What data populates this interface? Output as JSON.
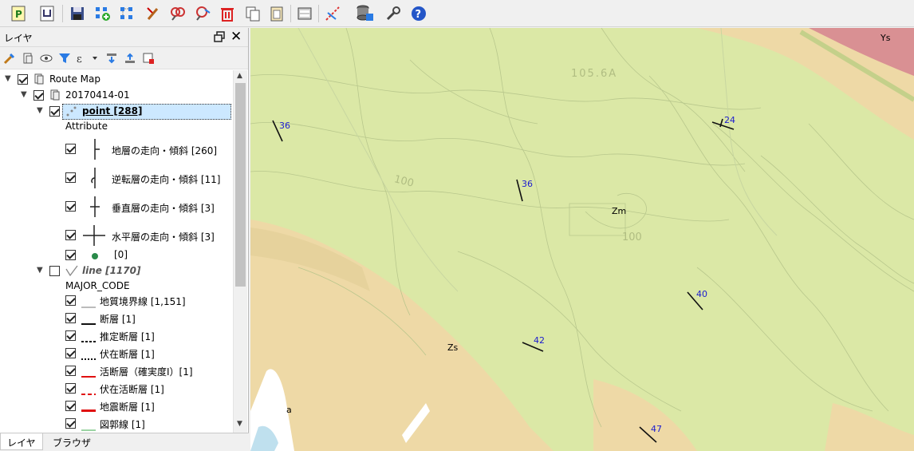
{
  "toolbar": {
    "icons": [
      "new-project-icon",
      "open-project-icon",
      "save-icon",
      "add-feature-icon",
      "select-feature-icon",
      "edit-pen-icon",
      "zoom-in-icon",
      "zoom-out-icon",
      "delete-icon",
      "copy-icon",
      "paste-icon",
      "print-layout-icon",
      "measure-icon",
      "database-icon",
      "settings-icon",
      "help-icon"
    ]
  },
  "panel": {
    "title": "レイヤ"
  },
  "tree": {
    "root": "Route Map",
    "group": "20170414-01",
    "point_layer": "point [288]",
    "point_attribute": "Attribute",
    "point_items": [
      "地層の走向・傾斜 [260]",
      "逆転層の走向・傾斜 [11]",
      "垂直層の走向・傾斜 [3]",
      "水平層の走向・傾斜 [3]",
      "[0]"
    ],
    "line_layer": "line [1170]",
    "line_attribute": "MAJOR_CODE",
    "line_items": [
      "地質境界線 [1,151]",
      "断層 [1]",
      "推定断層 [1]",
      "伏在断層 [1]",
      "活断層（確実度Ⅰ）[1]",
      "伏在活断層 [1]",
      "地震断層 [1]",
      "図郭線 [1]"
    ]
  },
  "tabs": [
    "レイヤ",
    "ブラウザ"
  ],
  "map": {
    "unit_labels": [
      "Ys",
      "Zm",
      "Zs",
      "a"
    ],
    "contour_labels": [
      "105.6A",
      "100",
      "100"
    ],
    "dip_values": [
      "36",
      "24",
      "36",
      "40",
      "42",
      "47"
    ]
  },
  "colors": {
    "zm_unit": "#dbe8a6",
    "zs_unit": "#edd8a7",
    "ys_unit": "#d99093",
    "selection": "#cce8ff",
    "dip_text": "#1a1ad0"
  }
}
